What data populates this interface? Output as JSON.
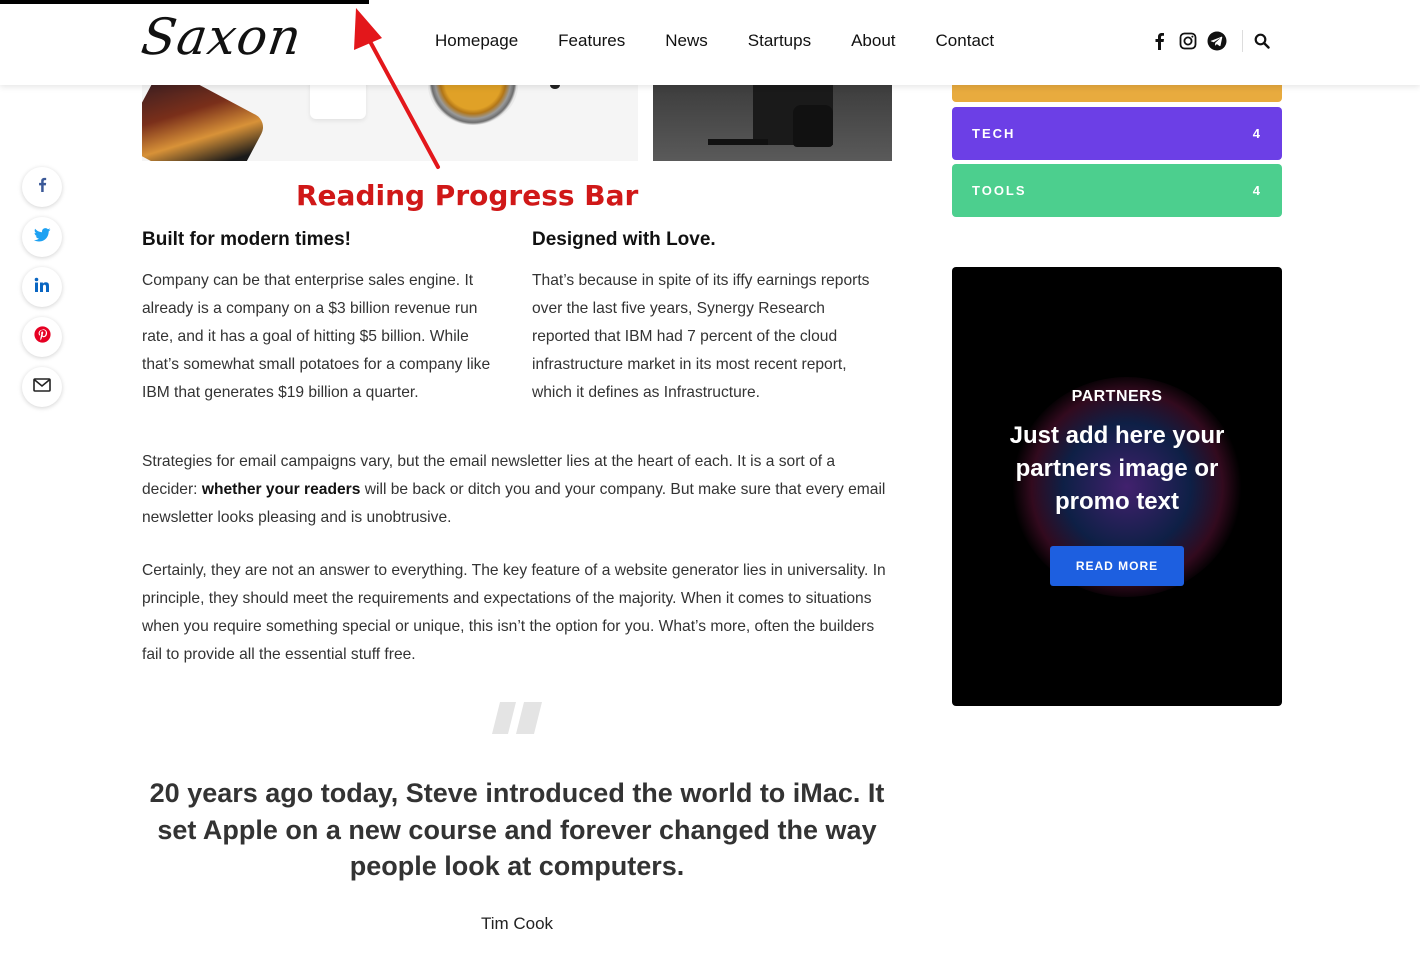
{
  "progress": {
    "fraction": 0.26
  },
  "header": {
    "logo": "Saxon",
    "nav": [
      "Homepage",
      "Features",
      "News",
      "Startups",
      "About",
      "Contact"
    ],
    "social_icons": [
      "facebook-icon",
      "instagram-icon",
      "telegram-icon"
    ],
    "search_icon": "search-icon"
  },
  "annotation": {
    "label": "Reading Progress Bar",
    "color": "#d01818"
  },
  "share": {
    "icons": [
      "facebook-icon",
      "twitter-icon",
      "linkedin-icon",
      "pinterest-icon",
      "mail-icon"
    ]
  },
  "content": {
    "col1": {
      "title": "Built for modern times!",
      "text": "Company can be that enterprise sales engine. It already is a company on a $3 billion revenue run rate, and it has a goal of hitting $5 billion. While that’s somewhat small potatoes for a company like IBM that generates $19 billion a quarter."
    },
    "col2": {
      "title": "Designed with Love.",
      "text": "That’s because in spite of its iffy earnings reports over the last five years, Synergy Research reported that IBM had 7 percent of the cloud infrastructure market in its most recent report, which it defines as Infrastructure."
    },
    "para1": {
      "before": "Strategies for email campaigns vary, but the email newsletter lies at the heart of each. It is a sort of a decider: ",
      "bold": "whether your readers",
      "after": " will be back or ditch you and your company. But make sure that every email newsletter looks pleasing and is unobtrusive."
    },
    "para2": "Certainly, they are not an answer to everything. The key feature of a website generator lies in universality. In principle, they should meet the requirements and expectations of the majority. When it comes to situations when you require something special or unique, this isn’t the option for you. What’s more, often the builders fail to provide all the essential stuff free.",
    "quote": "20 years ago today, Steve introduced the world to iMac. It set Apple on a new course and forever changed the way people look at computers.",
    "quote_author": "Tim Cook"
  },
  "sidebar": {
    "categories": [
      {
        "label": "TECH",
        "count": "4",
        "color": "#6c3fe6"
      },
      {
        "label": "TOOLS",
        "count": "4",
        "color": "#4ccf8e"
      }
    ],
    "top_category_color": "#e8ab3e",
    "promo": {
      "kicker": "PARTNERS",
      "title": "Just add here your partners image or promo text",
      "button": "READ MORE",
      "button_color": "#1d5fe0"
    }
  }
}
